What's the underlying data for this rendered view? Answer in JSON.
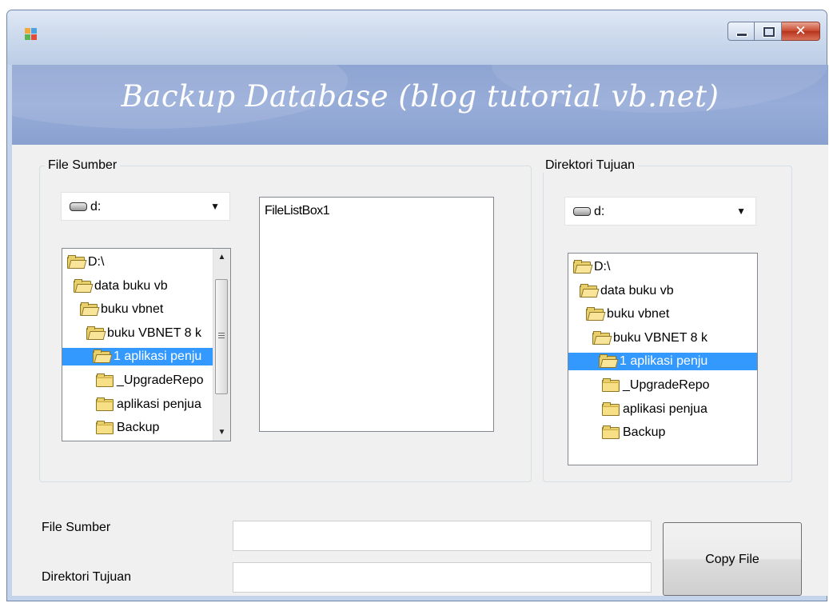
{
  "window": {
    "title": ""
  },
  "banner": {
    "title": "Backup Database (blog tutorial vb.net)"
  },
  "source_group": {
    "label": "File Sumber",
    "drive": "d:",
    "dirs": [
      {
        "label": "D:\\",
        "selected": false,
        "icon": "open-folder-icon"
      },
      {
        "label": "data buku vb",
        "selected": false,
        "icon": "open-folder-icon"
      },
      {
        "label": "buku vbnet",
        "selected": false,
        "icon": "open-folder-icon"
      },
      {
        "label": "buku VBNET 8 k",
        "selected": false,
        "icon": "open-folder-icon"
      },
      {
        "label": "1 aplikasi penju",
        "selected": true,
        "icon": "open-folder-icon"
      },
      {
        "label": "_UpgradeRepo",
        "selected": false,
        "icon": "folder-icon"
      },
      {
        "label": "aplikasi penjua",
        "selected": false,
        "icon": "folder-icon"
      },
      {
        "label": "Backup",
        "selected": false,
        "icon": "folder-icon"
      }
    ],
    "file_list_label": "FileListBox1"
  },
  "dest_group": {
    "label": "Direktori Tujuan",
    "drive": "d:",
    "dirs": [
      {
        "label": "D:\\",
        "selected": false,
        "icon": "open-folder-icon"
      },
      {
        "label": "data buku vb",
        "selected": false,
        "icon": "open-folder-icon"
      },
      {
        "label": "buku vbnet",
        "selected": false,
        "icon": "open-folder-icon"
      },
      {
        "label": "buku VBNET 8 k",
        "selected": false,
        "icon": "open-folder-icon"
      },
      {
        "label": "1 aplikasi penju",
        "selected": true,
        "icon": "open-folder-icon"
      },
      {
        "label": "_UpgradeRepo",
        "selected": false,
        "icon": "folder-icon"
      },
      {
        "label": "aplikasi penjua",
        "selected": false,
        "icon": "folder-icon"
      },
      {
        "label": "Backup",
        "selected": false,
        "icon": "folder-icon"
      }
    ]
  },
  "form": {
    "source_label": "File Sumber",
    "source_value": "",
    "dest_label": "Direktori Tujuan",
    "dest_value": "",
    "copy_button": "Copy File"
  },
  "colors": {
    "selection": "#3399ff",
    "banner": "#8ea4d2",
    "titlebar": "#cfdcee"
  }
}
